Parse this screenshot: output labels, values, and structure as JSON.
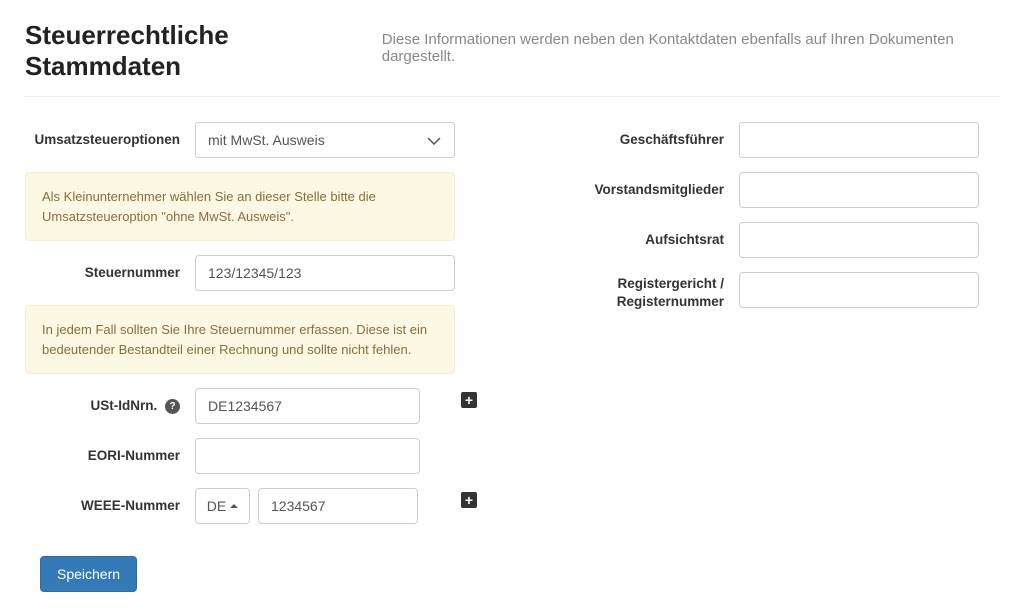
{
  "header": {
    "title": "Steuerrechtliche Stammdaten",
    "subtitle": "Diese Informationen werden neben den Kontaktdaten ebenfalls auf Ihren Dokumenten dargestellt."
  },
  "left": {
    "vat_options": {
      "label": "Umsatzsteueroptionen",
      "value": "mit MwSt. Ausweis"
    },
    "info1": "Als Kleinunternehmer wählen Sie an dieser Stelle bitte die Umsatzsteueroption \"ohne MwSt. Ausweis\".",
    "tax_number": {
      "label": "Steuernummer",
      "value": "123/12345/123"
    },
    "info2": "In jedem Fall sollten Sie Ihre Steuernummer erfassen. Diese ist ein bedeutender Bestandteil einer Rechnung und sollte nicht fehlen.",
    "vat_id": {
      "label": "USt-IdNrn.",
      "value": "DE1234567"
    },
    "eori": {
      "label": "EORI-Nummer",
      "value": ""
    },
    "weee": {
      "label": "WEEE-Nummer",
      "country": "DE",
      "value": "1234567"
    },
    "save": "Speichern"
  },
  "right": {
    "ceo": {
      "label": "Geschäftsführer",
      "value": ""
    },
    "board": {
      "label": "Vorstandsmitglieder",
      "value": ""
    },
    "supervisory": {
      "label": "Aufsichtsrat",
      "value": ""
    },
    "registry": {
      "label": "Registergericht / Registernummer",
      "value": ""
    }
  }
}
